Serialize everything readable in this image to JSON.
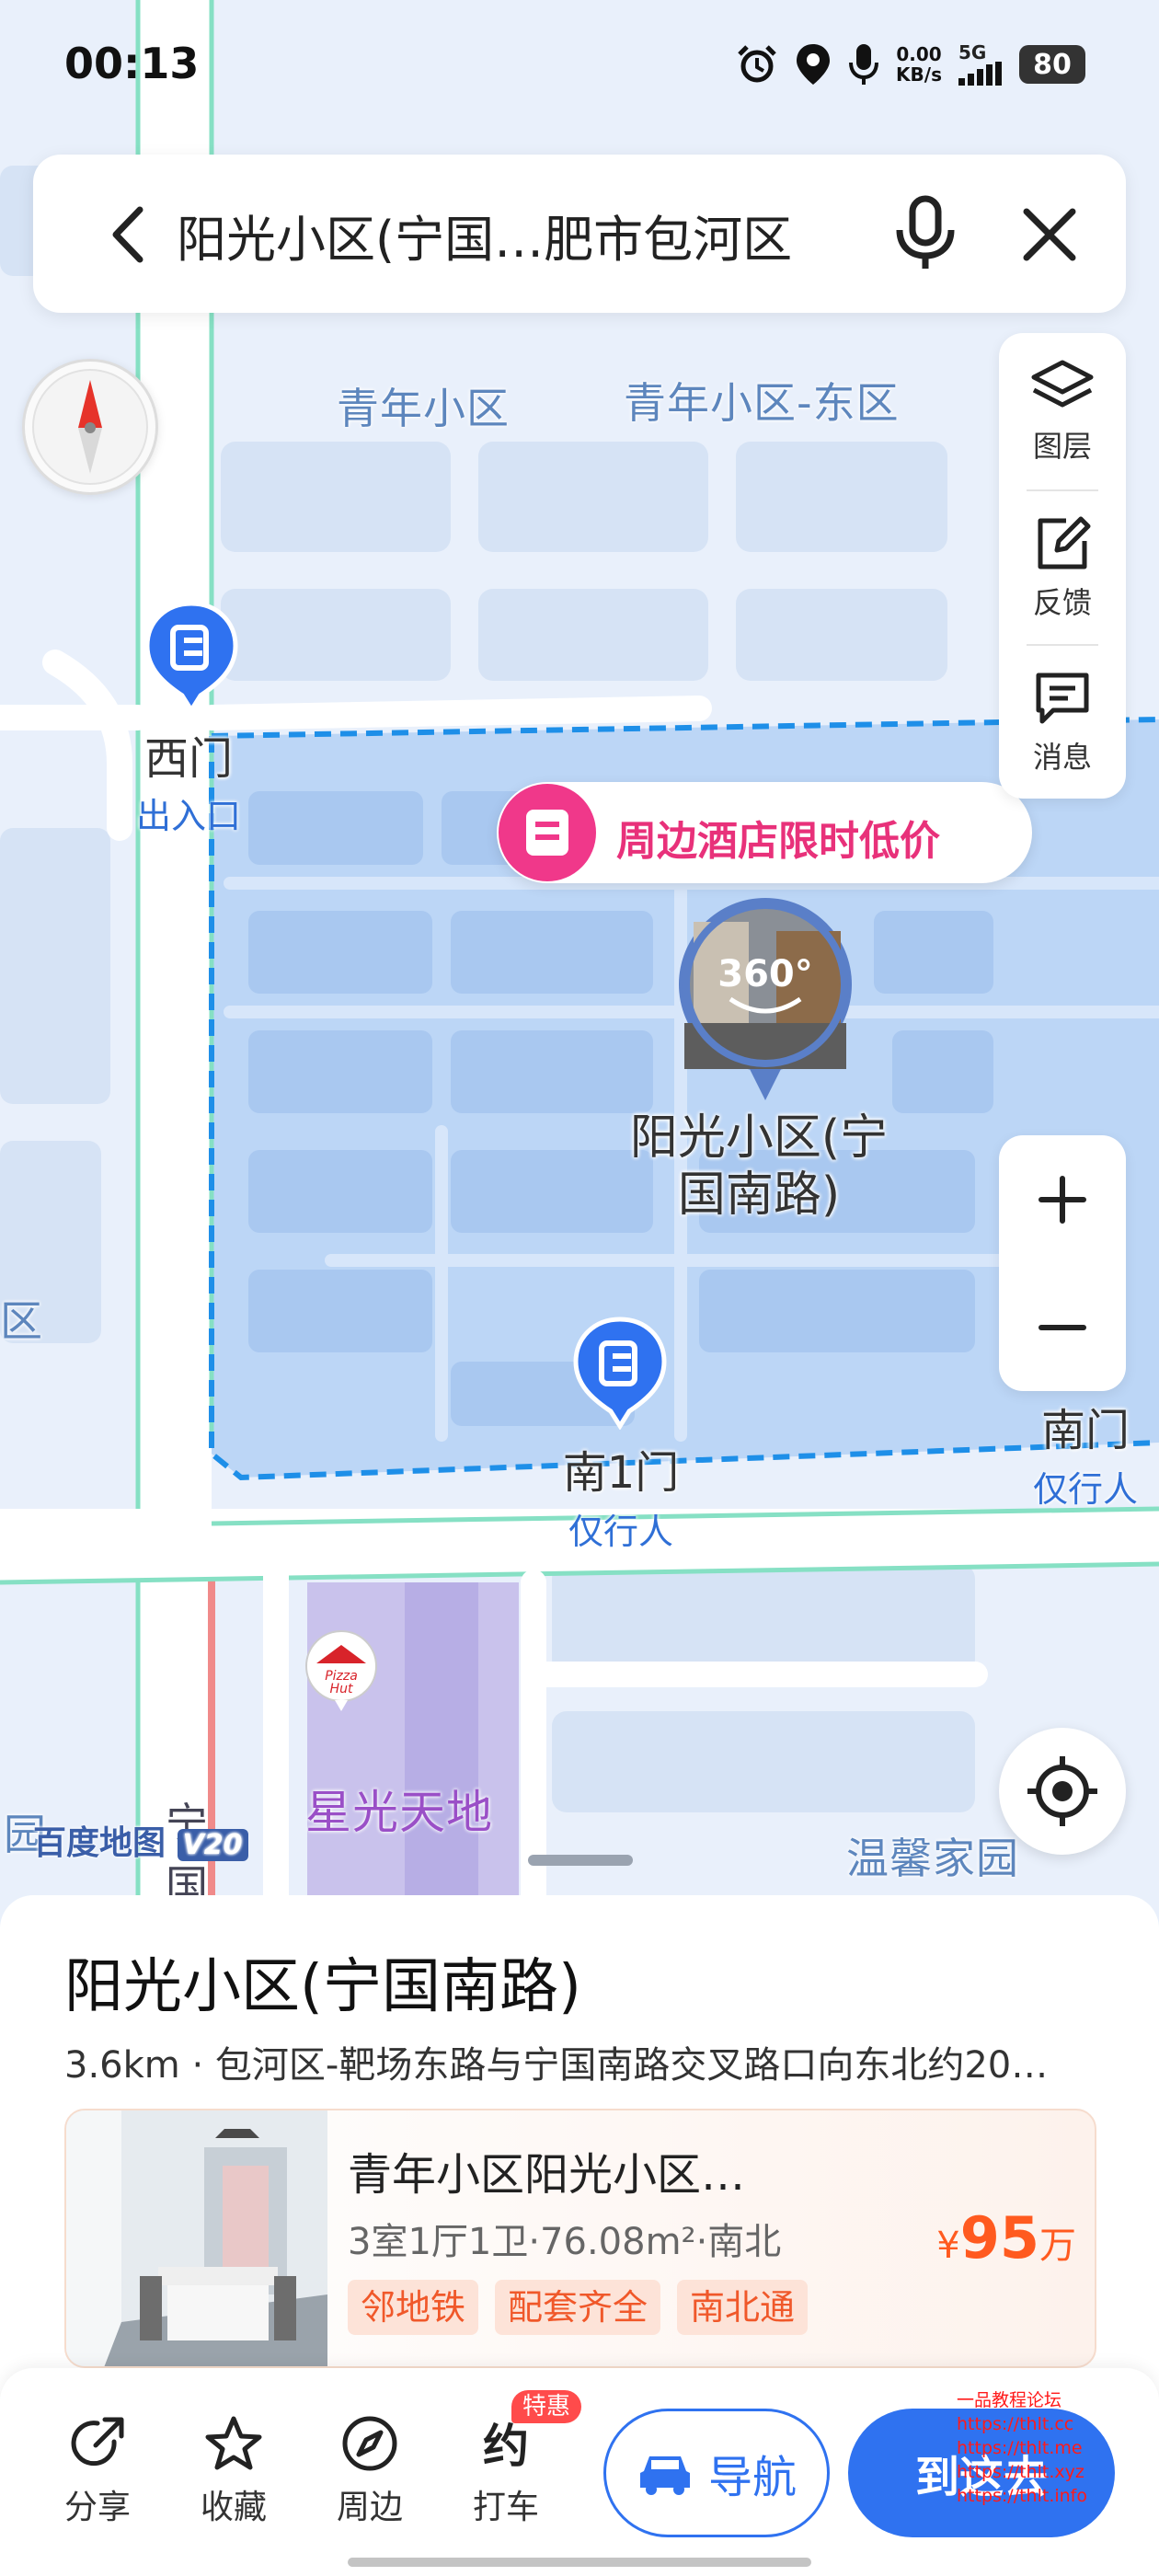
{
  "status_bar": {
    "time": "00:13",
    "net_speed": "0.00",
    "net_unit": "KB/s",
    "network": "5G",
    "battery": "80"
  },
  "search": {
    "query": "阳光小区(宁国…肥市包河区"
  },
  "tools": {
    "layers": "图层",
    "feedback": "反馈",
    "messages": "消息"
  },
  "map": {
    "labels": {
      "north_community": "青年小区",
      "north_east_community": "青年小区-东区",
      "west_partial": "区",
      "xingguang": "星光天地",
      "wenxin": "温馨家园",
      "bottom_left_partial": "园",
      "road_partial_1": "宁",
      "road_partial_2": "国"
    },
    "gates": {
      "west": {
        "name": "西门",
        "sub": "出入口"
      },
      "south1": {
        "name": "南1门",
        "sub": "仅行人"
      },
      "south": {
        "name": "南门",
        "sub": "仅行人"
      }
    },
    "promo": "周边酒店限时低价",
    "pano_label": "360°",
    "poi_name_line1": "阳光小区(宁",
    "poi_name_line2": "国南路)",
    "logo_text": "百度地图",
    "logo_version": "V20"
  },
  "place": {
    "title": "阳光小区(宁国南路)",
    "address": "3.6km · 包河区-靶场东路与宁国南路交叉路口向东北约20…"
  },
  "listing": {
    "title": "青年小区阳光小区…",
    "info": "3室1厅1卫·76.08m²·南北",
    "price_currency": "¥",
    "price_value": "95",
    "price_unit": "万",
    "tags": [
      "邻地铁",
      "配套齐全",
      "南北通"
    ]
  },
  "actions": {
    "share": "分享",
    "favorite": "收藏",
    "nearby": "周边",
    "taxi": "打车",
    "taxi_badge": "特惠",
    "navigate": "导航",
    "go_here": "到这去"
  },
  "watermark": [
    "一品教程论坛",
    "https://thlt.cc",
    "https://thlt.me",
    "https://thlt.xyz",
    "https://thlt.info"
  ],
  "colors": {
    "accent": "#2f72f0",
    "promo": "#e8317a",
    "price": "#ff5a1f",
    "map_area": "#bcd6f6"
  }
}
